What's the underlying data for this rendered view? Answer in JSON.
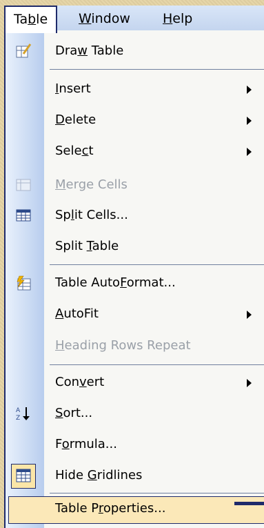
{
  "menubar": {
    "items": [
      {
        "pre": "Ta",
        "ul": "b",
        "post": "le"
      },
      {
        "pre": "",
        "ul": "W",
        "post": "indow"
      },
      {
        "pre": "",
        "ul": "H",
        "post": "elp"
      }
    ]
  },
  "menu": {
    "draw_table": {
      "pre": "Dra",
      "ul": "w",
      "post": " Table"
    },
    "insert": {
      "pre": "",
      "ul": "I",
      "post": "nsert"
    },
    "delete": {
      "pre": "",
      "ul": "D",
      "post": "elete"
    },
    "select": {
      "pre": "Sele",
      "ul": "c",
      "post": "t"
    },
    "merge_cells": {
      "pre": "",
      "ul": "M",
      "post": "erge Cells"
    },
    "split_cells": {
      "pre": "Sp",
      "ul": "l",
      "post": "it Cells..."
    },
    "split_table": {
      "pre": "Split ",
      "ul": "T",
      "post": "able"
    },
    "autoformat": {
      "pre": "Table Auto",
      "ul": "F",
      "post": "ormat..."
    },
    "autofit": {
      "pre": "",
      "ul": "A",
      "post": "utoFit"
    },
    "heading_rows": {
      "pre": "",
      "ul": "H",
      "post": "eading Rows Repeat"
    },
    "convert": {
      "pre": "Con",
      "ul": "v",
      "post": "ert"
    },
    "sort": {
      "pre": "",
      "ul": "S",
      "post": "ort..."
    },
    "formula": {
      "pre": "F",
      "ul": "o",
      "post": "rmula..."
    },
    "hide_gridlines": {
      "pre": "Hide ",
      "ul": "G",
      "post": "ridlines"
    },
    "table_properties": {
      "pre": "Table P",
      "ul": "r",
      "post": "operties..."
    }
  },
  "colors": {
    "accent": "#1e2a6a",
    "highlight": "#fbe8b8",
    "gutter": "#b8cdee",
    "background": "#e4d3a4"
  }
}
